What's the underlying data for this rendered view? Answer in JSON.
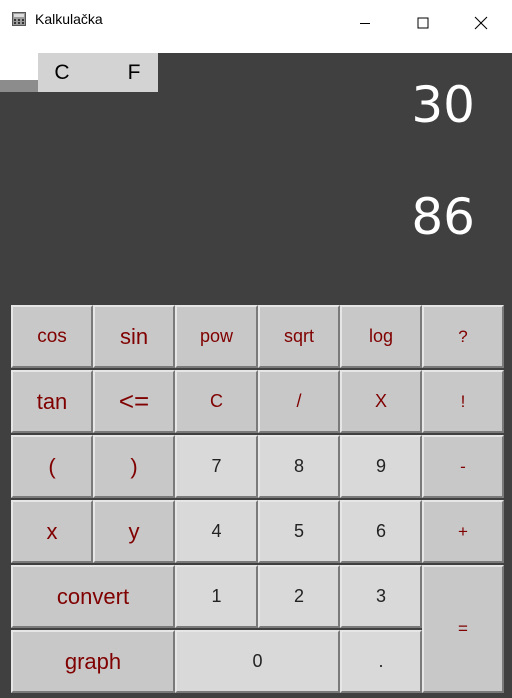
{
  "window": {
    "title": "Kalkulačka",
    "icon": "calculator-icon"
  },
  "unit_tabs": [
    "C",
    "F"
  ],
  "display": {
    "celsius_value": "30",
    "fahrenheit_value": "86"
  },
  "keys": {
    "cos": "cos",
    "sin": "sin",
    "pow": "pow",
    "sqrt": "sqrt",
    "log": "log",
    "help": "?",
    "tan": "tan",
    "backspace": "<=",
    "clear": "C",
    "divide": "/",
    "multiply": "X",
    "factorial": "!",
    "open_paren": "(",
    "close_paren": ")",
    "seven": "7",
    "eight": "8",
    "nine": "9",
    "minus": "-",
    "x": "x",
    "y": "y",
    "four": "4",
    "five": "5",
    "six": "6",
    "plus": "+",
    "convert": "convert",
    "one": "1",
    "two": "2",
    "three": "3",
    "equals": "=",
    "graph": "graph",
    "zero": "0",
    "decimal": "."
  },
  "colors": {
    "background": "#404040",
    "key_face": "#c8c8c8",
    "key_face_light": "#d9d9d9",
    "key_text": "#800000",
    "display_text": "#ffffff"
  }
}
